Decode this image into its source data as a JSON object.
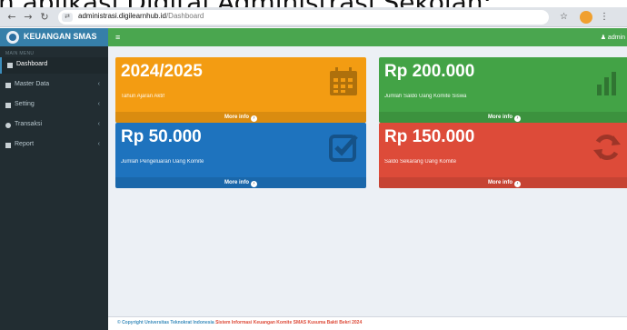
{
  "caption": "n aplikasi Digital Administrasi Sekolah:",
  "browser": {
    "url_domain": "administrasi.digilearnhub.id",
    "url_path": "/Dashboard",
    "back_icon": "arrow-left-icon",
    "forward_icon": "arrow-right-icon",
    "reload_icon": "reload-icon",
    "star_icon": "star-icon",
    "tabs_icon": "tab-icon"
  },
  "sidebar": {
    "app_title": "KEUANGAN SMAS",
    "menu_header": "MAIN MENU",
    "items": [
      {
        "label": "Dashboard",
        "active": true,
        "has_arrow": false,
        "icon": "dashboard-icon"
      },
      {
        "label": "Master Data",
        "active": false,
        "has_arrow": true,
        "icon": "folder-icon"
      },
      {
        "label": "Setting",
        "active": false,
        "has_arrow": true,
        "icon": "gear-icon"
      },
      {
        "label": "Transaksi",
        "active": false,
        "has_arrow": true,
        "icon": "transaction-icon"
      },
      {
        "label": "Report",
        "active": false,
        "has_arrow": true,
        "icon": "report-icon"
      }
    ],
    "arrow_glyph": "‹"
  },
  "topbar": {
    "menu_glyph": "≡",
    "user": "admin"
  },
  "boxes": [
    {
      "value": "2024/2025",
      "desc": "Tahun Ajaran Aktif",
      "footer": "More info",
      "color": "#f39c12",
      "icon": "calendar-icon"
    },
    {
      "value": "Rp 200.000",
      "desc": "Jumlah Saldo Uang Komite Siswa",
      "footer": "More info",
      "color": "#43a346",
      "icon": "bar-chart-icon"
    },
    {
      "value": "Rp 50.000",
      "desc": "Jumlah Pengeluaran Uang Komite",
      "footer": "More info",
      "color": "#1e73be",
      "icon": "checkbox-icon"
    },
    {
      "value": "Rp 150.000",
      "desc": "Saldo Sekarang Uang Komite",
      "footer": "More info",
      "color": "#dd4b39",
      "icon": "refresh-icon"
    }
  ],
  "footer": {
    "copyright": "© Copyright Universitas Teknokrat Indonesia",
    "system": "Sistem Informasi Keuangan Komite SMAS Kusuma Bakti Bekri 2024"
  }
}
